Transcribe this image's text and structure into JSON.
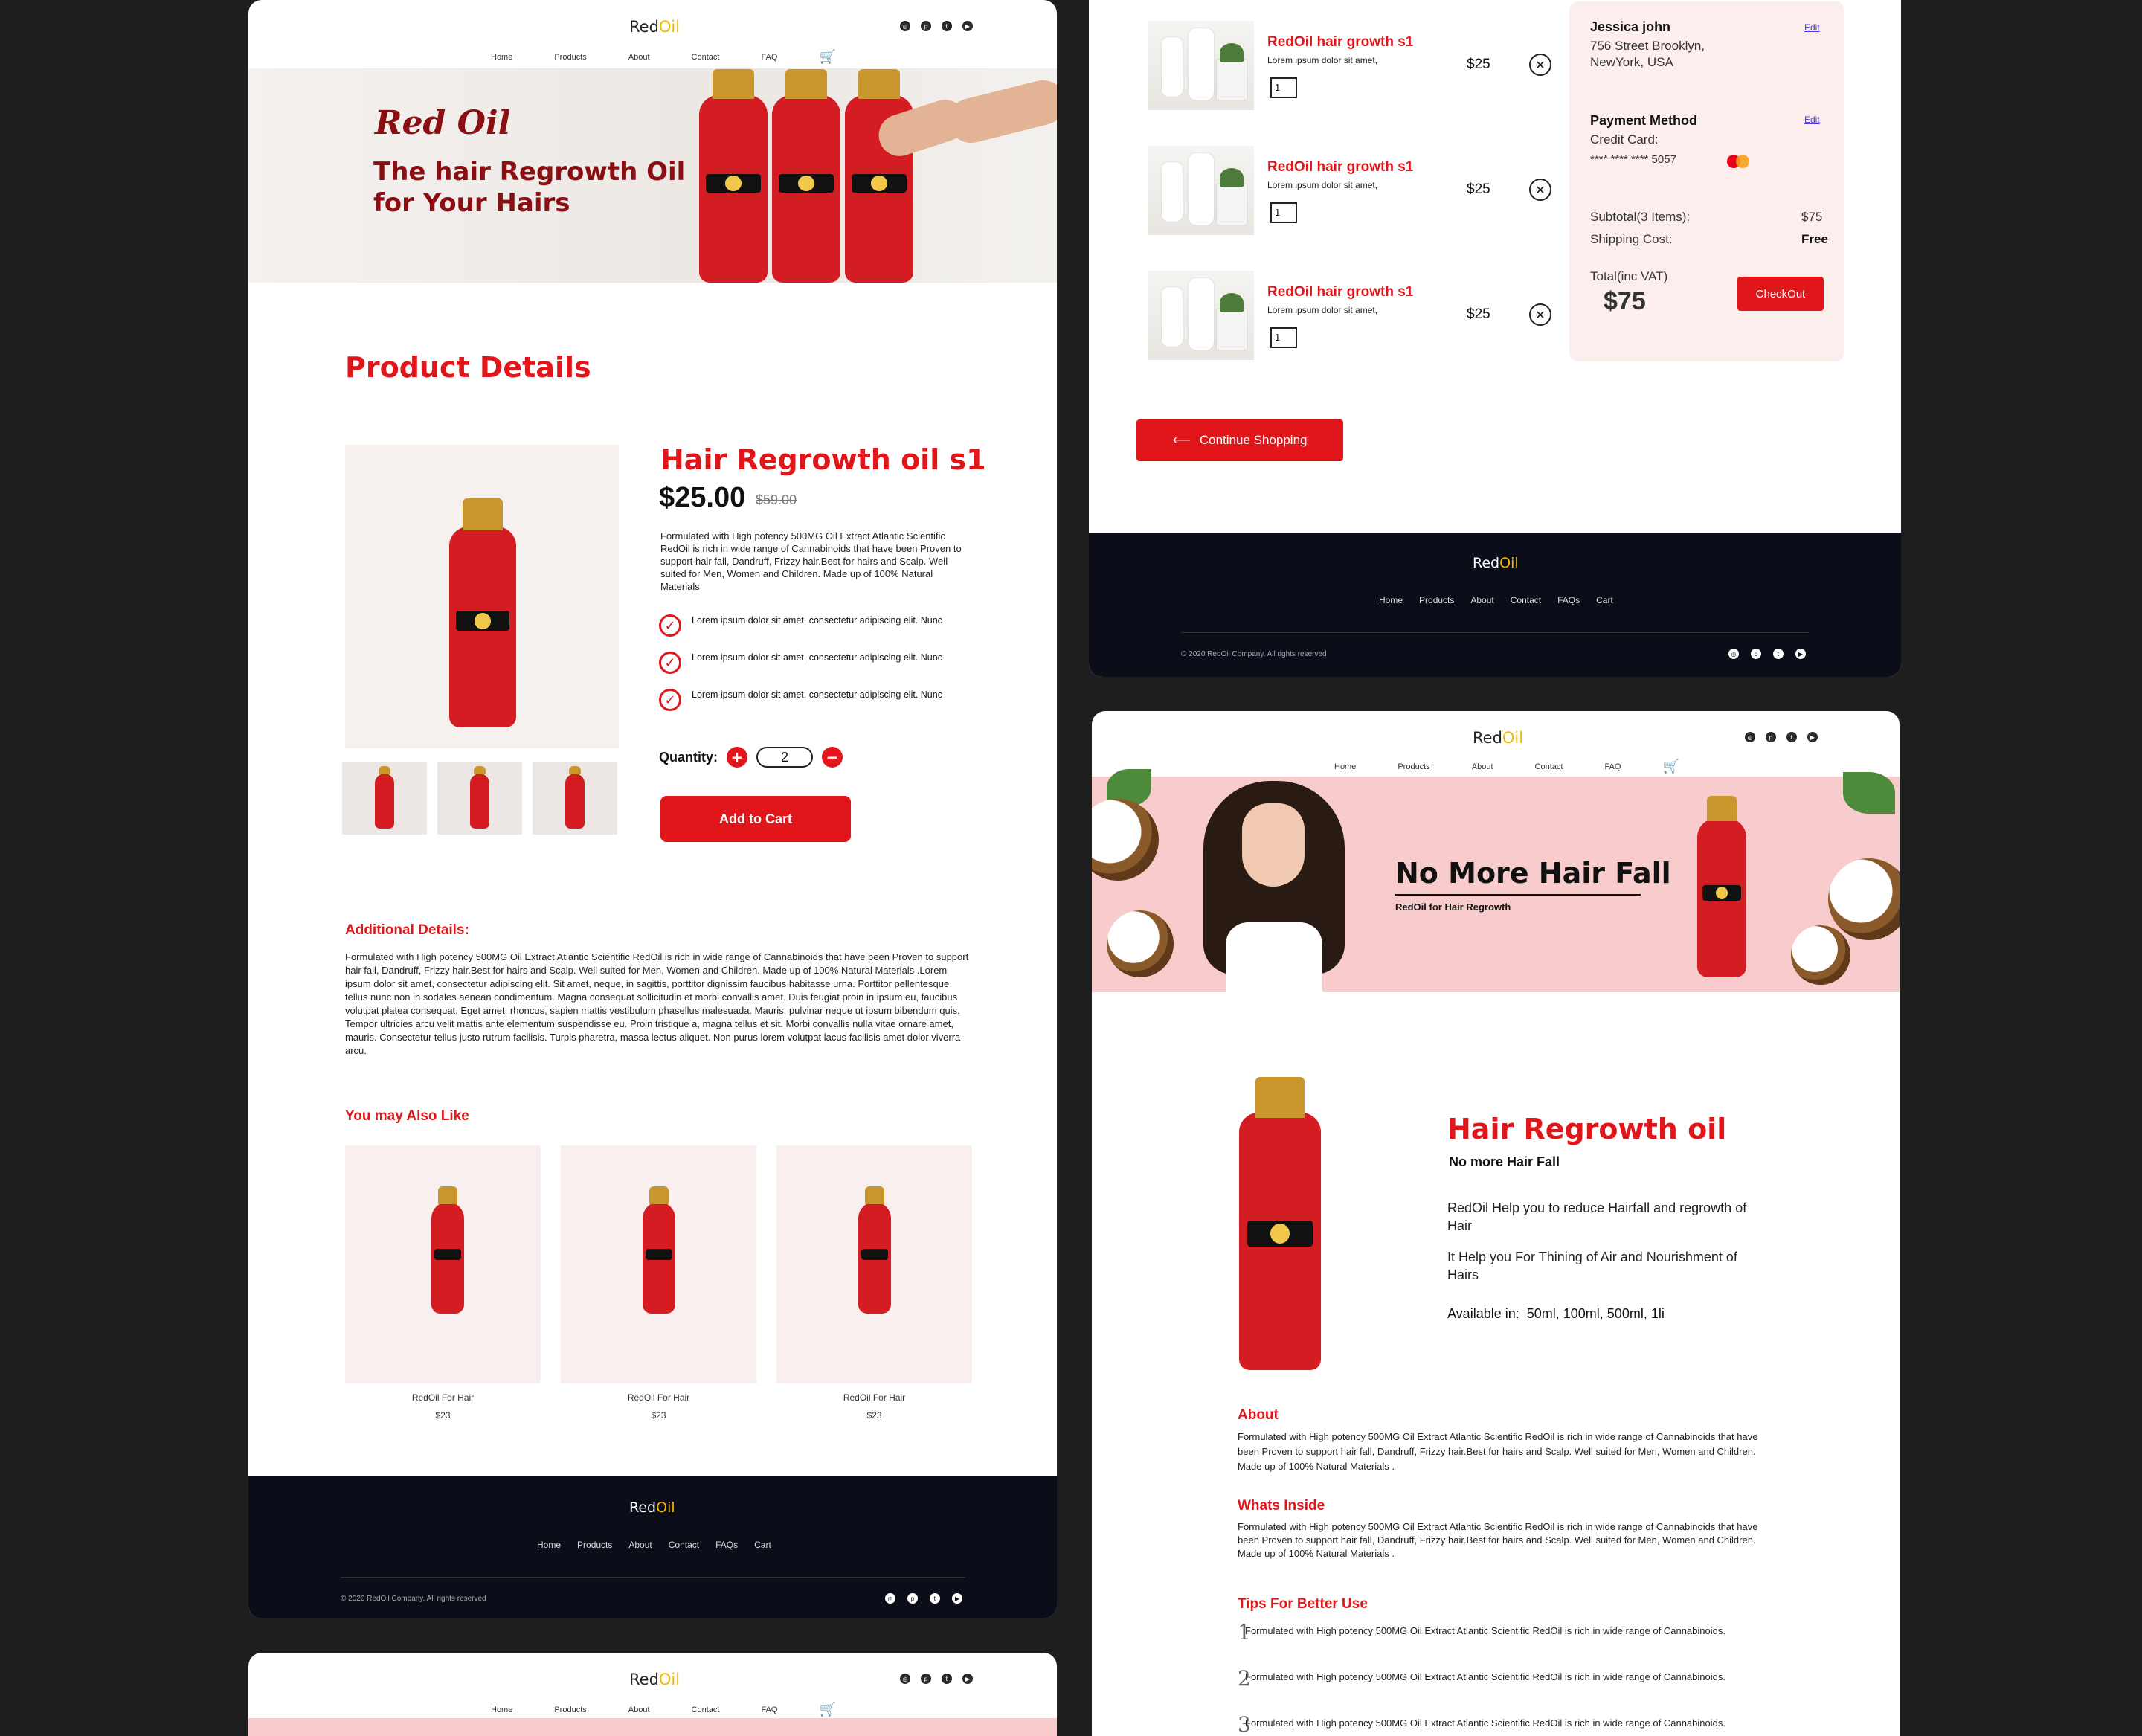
{
  "brand": {
    "part1": "Red",
    "part2": "Oil"
  },
  "nav": {
    "home": "Home",
    "products": "Products",
    "about": "About",
    "contact": "Contact",
    "faq": "FAQ"
  },
  "socials": [
    "instagram-icon",
    "pinterest-icon",
    "twitter-icon",
    "youtube-icon"
  ],
  "hero1": {
    "script": "Red Oil",
    "title": "The hair Regrowth Oil for Your Hairs"
  },
  "product": {
    "section_title": "Product Details",
    "name": "Hair Regrowth oil s1",
    "price": "$25.00",
    "old_price": "$59.00",
    "description": "Formulated with High potency 500MG Oil Extract Atlantic Scientific RedOil is rich in wide range of Cannabinoids that have been Proven to support hair fall, Dandruff, Frizzy hair.Best for hairs and Scalp. Well suited for Men, Women and Children. Made up of 100% Natural Materials",
    "features": [
      "Lorem ipsum dolor sit amet, consectetur adipiscing elit. Nunc",
      "Lorem ipsum dolor sit amet, consectetur adipiscing elit. Nunc",
      "Lorem ipsum dolor sit amet, consectetur adipiscing elit. Nunc"
    ],
    "quantity_label": "Quantity:",
    "quantity": "2",
    "add_to_cart": "Add to Cart"
  },
  "additional": {
    "title": "Additional Details:",
    "text": "Formulated with High potency 500MG Oil Extract Atlantic Scientific RedOil is rich in wide range of Cannabinoids that have been Proven to support hair fall, Dandruff, Frizzy hair.Best for hairs and Scalp. Well suited for Men, Women and Children. Made up of 100% Natural Materials .Lorem ipsum dolor sit amet, consectetur adipiscing elit. Sit amet, neque, in sagittis, porttitor dignissim faucibus habitasse urna. Porttitor pellentesque tellus nunc non in sodales aenean condimentum. Magna consequat sollicitudin et morbi convallis amet. Duis feugiat proin in ipsum eu, faucibus volutpat platea consequat. Eget amet, rhoncus, sapien mattis vestibulum phasellus malesuada. Mauris, pulvinar neque ut ipsum bibendum quis. Tempor ultricies arcu velit mattis ante elementum suspendisse eu. Proin tristique a, magna tellus et sit. Morbi convallis nulla vitae ornare amet, mauris. Consectetur tellus justo rutrum facilisis. Turpis pharetra, massa lectus aliquet. Non purus lorem volutpat lacus facilisis amet dolor viverra arcu."
  },
  "related": {
    "title": "You may Also Like",
    "items": [
      {
        "name": "RedOil For Hair",
        "price": "$23"
      },
      {
        "name": "RedOil For Hair",
        "price": "$23"
      },
      {
        "name": "RedOil For Hair",
        "price": "$23"
      }
    ]
  },
  "footer": {
    "links": [
      "Home",
      "Products",
      "About",
      "Contact",
      "FAQs",
      "Cart"
    ],
    "copyright": "© 2020 RedOil Company. All rights reserved"
  },
  "cart": {
    "items": [
      {
        "title": "RedOil hair growth s1",
        "sub": "Lorem ipsum dolor sit amet,",
        "qty": "1",
        "price": "$25"
      },
      {
        "title": "RedOil hair growth s1",
        "sub": "Lorem ipsum dolor sit amet,",
        "qty": "1",
        "price": "$25"
      },
      {
        "title": "RedOil hair growth s1",
        "sub": "Lorem ipsum dolor sit amet,",
        "qty": "1",
        "price": "$25"
      }
    ],
    "continue": "Continue Shopping",
    "customer_name": "Jessica john",
    "address1": "756 Street Brooklyn,",
    "address2": "NewYork, USA",
    "edit": "Edit",
    "payment_title": "Payment Method",
    "card_label": "Credit Card:",
    "card_number": "****  ****  ****  5057",
    "subtotal_label": "Subtotal(3 Items):",
    "subtotal": "$75",
    "shipping_label": "Shipping Cost:",
    "shipping": "Free",
    "total_label": "Total(inc VAT)",
    "total": "$75",
    "checkout": "CheckOut"
  },
  "page3": {
    "hero_title": "No More Hair Fall",
    "hero_sub": "RedOil for Hair Regrowth",
    "title": "Hair Regrowth oil",
    "subtitle": "No more Hair Fall",
    "p1": "RedOil  Help you to reduce Hairfall and regrowth of Hair",
    "p2": "It Help you For Thining of Air and Nourishment of Hairs",
    "available_label": "Available in:",
    "available": "50ml, 100ml, 500ml, 1li",
    "about_title": "About",
    "about_text": "Formulated with High potency 500MG Oil Extract Atlantic Scientific RedOil is rich in wide range of Cannabinoids that have been Proven to support hair fall, Dandruff, Frizzy hair.Best for hairs and Scalp. Well suited for Men, Women and Children. Made up of 100% Natural Materials .",
    "inside_title": "Whats Inside",
    "inside_text": "Formulated with High potency 500MG Oil Extract Atlantic Scientific RedOil is rich in wide range of Cannabinoids that have been Proven to support hair fall, Dandruff, Frizzy hair.Best for hairs and Scalp. Well suited for Men, Women and Children. Made up of 100% Natural Materials .",
    "tips_title": "Tips For Better Use",
    "tips": [
      {
        "n": "1",
        "text": "Formulated with High potency 500MG Oil Extract Atlantic Scientific RedOil is rich in wide range of Cannabinoids."
      },
      {
        "n": "2",
        "text": "Formulated with High potency 500MG Oil Extract Atlantic Scientific RedOil is rich in wide range of Cannabinoids."
      },
      {
        "n": "3",
        "text": "Formulated with High potency 500MG Oil Extract Atlantic Scientific RedOil is rich in wide range of Cannabinoids."
      }
    ]
  },
  "colors": {
    "accent": "#e0161b",
    "dark": "#0b0e18",
    "brand_dark_red": "#8a0e12",
    "oil_yellow": "#f2b705"
  }
}
